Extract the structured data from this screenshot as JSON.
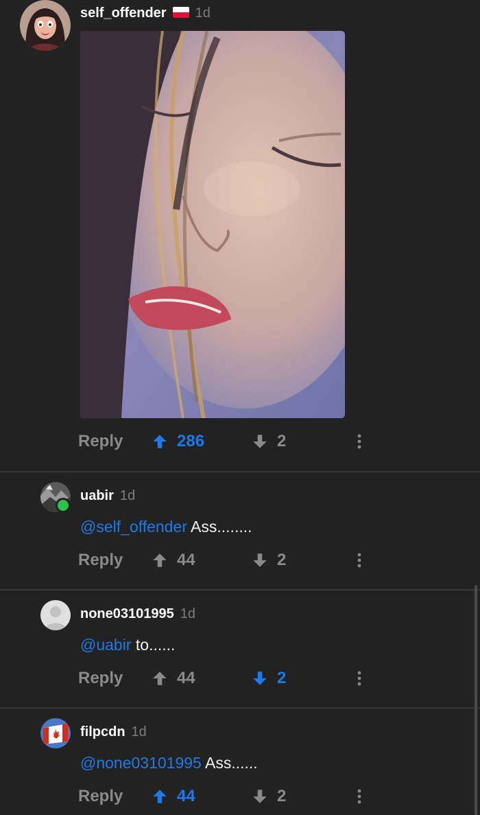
{
  "colors": {
    "background": "#222222",
    "accent": "#1e7ae8",
    "muted": "#8a8a8a"
  },
  "comments": [
    {
      "username": "self_offender",
      "flag": "poland-flag",
      "time": "1d",
      "has_image": true,
      "reply_label": "Reply",
      "upvotes": "286",
      "downvotes": "2",
      "upvoted": true,
      "downvoted": false
    },
    {
      "username": "uabir",
      "time": "1d",
      "mention": "@self_offender",
      "text": " Ass........",
      "reply_label": "Reply",
      "upvotes": "44",
      "downvotes": "2",
      "upvoted": false,
      "downvoted": false
    },
    {
      "username": "none03101995",
      "time": "1d",
      "mention": "@uabir",
      "text": " to......",
      "reply_label": "Reply",
      "upvotes": "44",
      "downvotes": "2",
      "upvoted": false,
      "downvoted": true
    },
    {
      "username": "filpcdn",
      "time": "1d",
      "mention": "@none03101995",
      "text": " Ass......",
      "reply_label": "Reply",
      "upvotes": "44",
      "downvotes": "2",
      "upvoted": true,
      "downvoted": false
    }
  ]
}
